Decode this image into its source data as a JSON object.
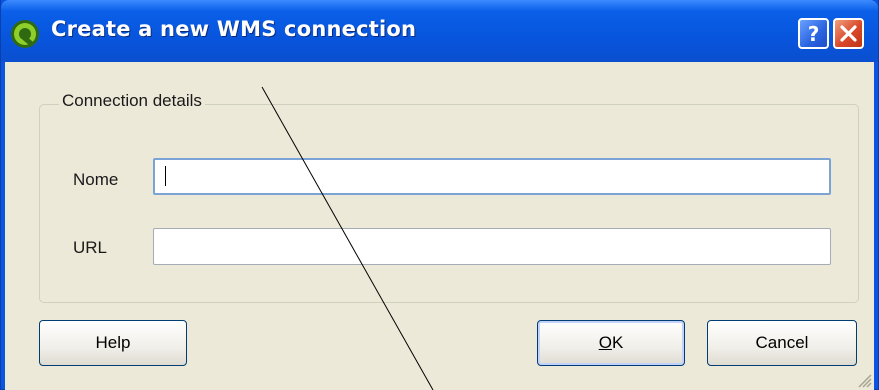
{
  "window": {
    "title": "Create a new WMS connection",
    "title_bar_color": "#0A5FE8",
    "client_bg": "#ECE9D8",
    "help_icon": "question-mark-icon",
    "close_icon": "close-x-icon"
  },
  "group": {
    "legend": "Connection details"
  },
  "form": {
    "name_label": "Nome",
    "name_value": "",
    "url_label": "URL",
    "url_value": ""
  },
  "buttons": {
    "help": "Help",
    "ok_mnemonic": "O",
    "ok_rest": "K",
    "cancel": "Cancel"
  }
}
